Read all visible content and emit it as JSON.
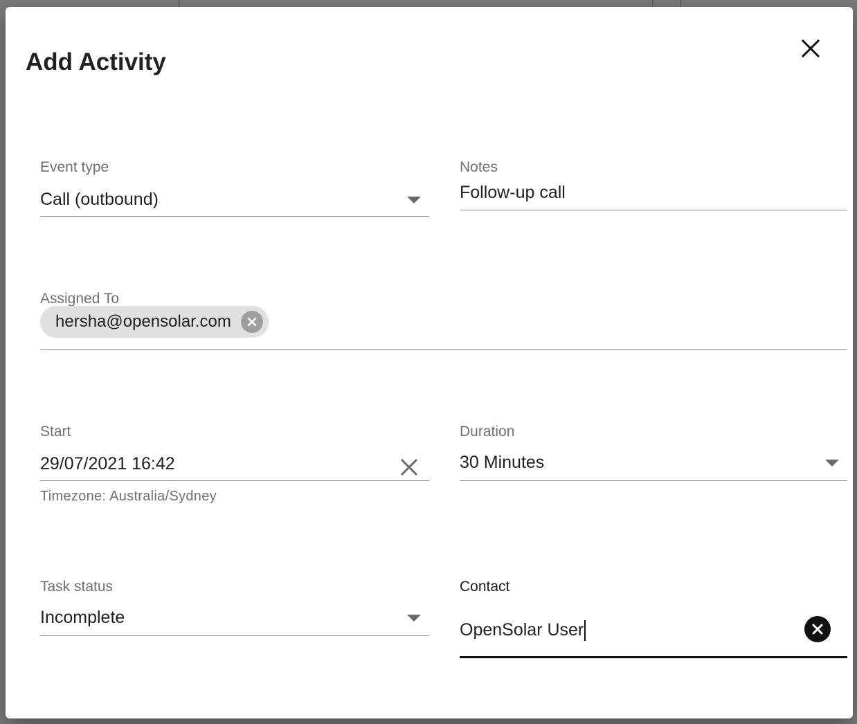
{
  "dialog": {
    "title": "Add Activity",
    "close_icon": "close-icon"
  },
  "fields": {
    "event_type": {
      "label": "Event type",
      "value": "Call (outbound)",
      "icon": "dropdown-arrow-icon"
    },
    "notes": {
      "label": "Notes",
      "value": "Follow-up call"
    },
    "assigned_to": {
      "label": "Assigned To",
      "chip": "hersha@opensolar.com",
      "chip_icon": "remove-chip-icon"
    },
    "start": {
      "label": "Start",
      "value": "29/07/2021 16:42",
      "helper": "Timezone: Australia/Sydney",
      "icon": "clear-icon"
    },
    "duration": {
      "label": "Duration",
      "value": "30 Minutes",
      "icon": "dropdown-arrow-icon"
    },
    "task_status": {
      "label": "Task status",
      "value": "Incomplete",
      "icon": "dropdown-arrow-icon"
    },
    "contact": {
      "label": "Contact",
      "value": "OpenSolar User",
      "icon": "clear-circle-icon"
    }
  },
  "colors": {
    "overlay": "#7a7a7a",
    "dialog_bg": "#ffffff",
    "chip_bg": "#e0e0e0"
  }
}
